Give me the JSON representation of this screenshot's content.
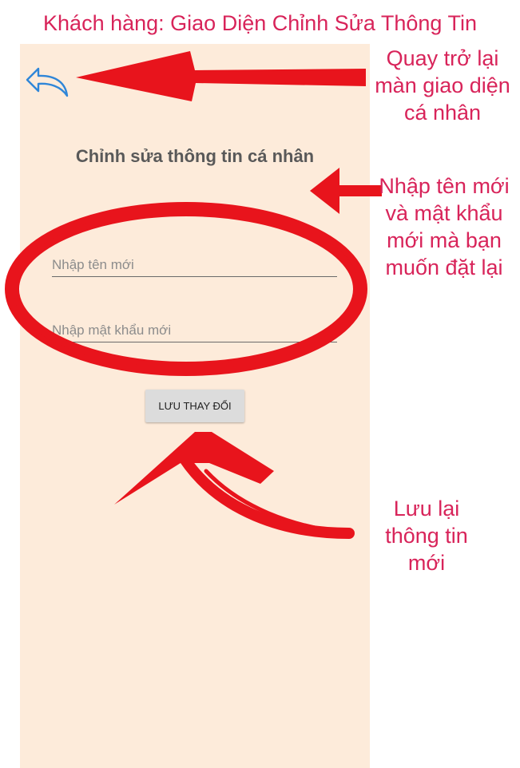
{
  "doc_title": "Khách hàng: Giao Diện Chỉnh Sửa Thông Tin",
  "screen": {
    "heading": "Chỉnh sửa thông tin cá nhân",
    "back_icon": "back-arrow-icon",
    "name_field": {
      "placeholder": "Nhập tên mới",
      "value": ""
    },
    "password_field": {
      "placeholder": "Nhập mật khẩu mới",
      "value": ""
    },
    "save_button_label": "LƯU THAY ĐỔI"
  },
  "annotations": {
    "back": "Quay trở lại màn giao diện cá nhân",
    "inputs": "Nhập tên mới và mật khẩu mới mà bạn muốn đặt lại",
    "save": "Lưu lại thông tin mới"
  },
  "colors": {
    "annotation_text": "#d8245a",
    "marker_red": "#e8141c",
    "screen_background": "#fdebda",
    "back_icon": "#2f86d8"
  }
}
